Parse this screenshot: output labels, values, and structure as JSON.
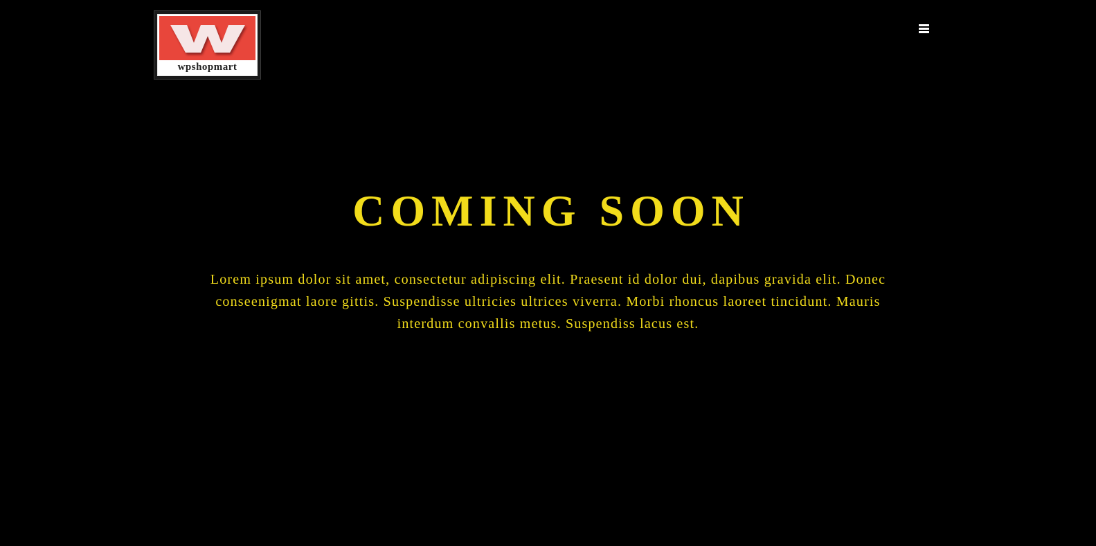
{
  "header": {
    "logo_text": "wpshopmart",
    "logo_icon": "w-logo",
    "menu_icon": "hamburger-menu-icon"
  },
  "hero": {
    "title": "COMING SOON",
    "description": "Lorem ipsum dolor sit amet, consectetur adipiscing elit. Praesent id dolor dui, dapibus gravida elit. Donec conseenigmat laore gittis. Suspendisse ultricies ultrices viverra. Morbi rhoncus laoreet tincidunt. Mauris interdum convallis metus. Suspendiss lacus est."
  },
  "colors": {
    "background": "#000000",
    "accent": "#f2dc1b",
    "logo_red": "#e8463b",
    "menu_icon": "#ffffff"
  }
}
